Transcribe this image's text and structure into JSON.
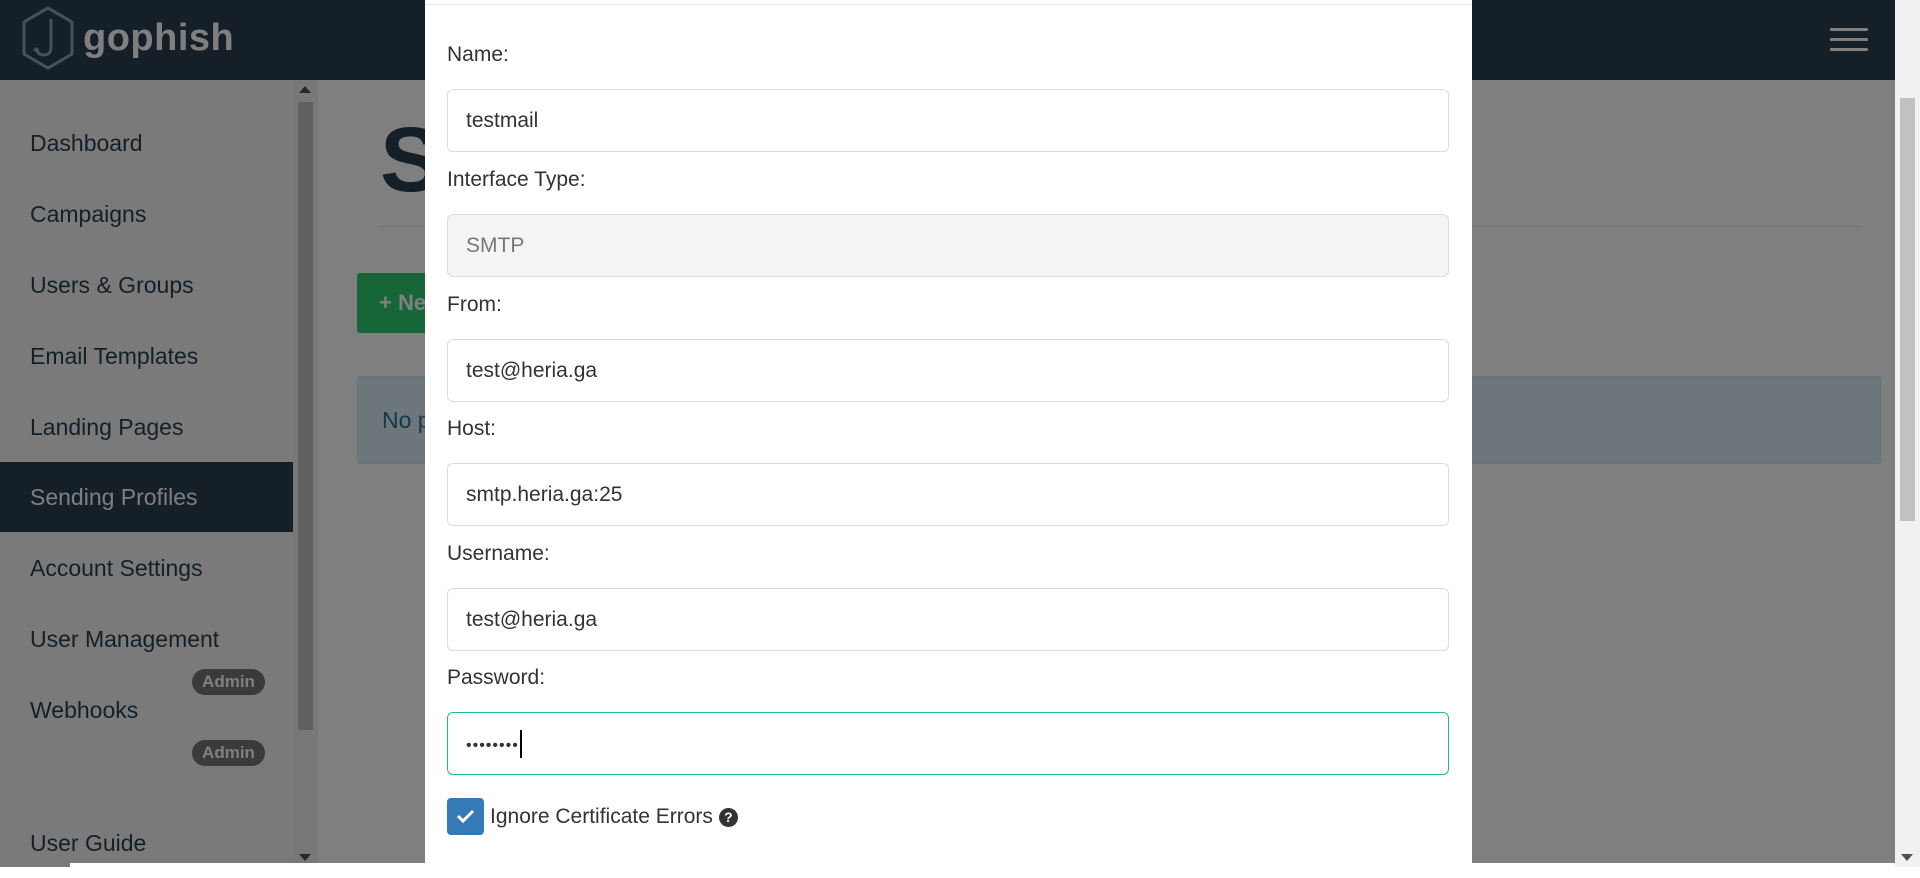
{
  "navbar": {
    "brand": "gophish"
  },
  "sidebar": {
    "items": [
      {
        "label": "Dashboard"
      },
      {
        "label": "Campaigns"
      },
      {
        "label": "Users & Groups"
      },
      {
        "label": "Email Templates"
      },
      {
        "label": "Landing Pages"
      },
      {
        "label": "Sending Profiles",
        "active": true
      },
      {
        "label": "Account Settings"
      },
      {
        "label": "User Management"
      },
      {
        "label": "Webhooks"
      },
      {
        "label": "User Guide"
      }
    ],
    "admin_badge": "Admin"
  },
  "main": {
    "title_fragment": "S",
    "new_button": "+ Ne",
    "alert_fragment": "No p"
  },
  "modal": {
    "name_label": "Name:",
    "name_value": "testmail",
    "interface_type_label": "Interface Type:",
    "interface_type_value": "SMTP",
    "from_label": "From:",
    "from_value": "test@heria.ga",
    "host_label": "Host:",
    "host_value": "smtp.heria.ga:25",
    "username_label": "Username:",
    "username_value": "test@heria.ga",
    "password_label": "Password:",
    "password_mask": "••••••••",
    "ignore_cert_label": "Ignore Certificate Errors",
    "ignore_cert_checked": true
  },
  "colors": {
    "navbar": "#283f50",
    "active_item": "#283f50",
    "new_button": "#2ecc71",
    "checkbox": "#337ab7",
    "focus_border": "#1abc9c"
  },
  "icons": {
    "logo": "gophish-hexagon-hook-icon",
    "menu": "hamburger-menu-icon",
    "help": "question-circle-icon",
    "check": "check-icon"
  }
}
